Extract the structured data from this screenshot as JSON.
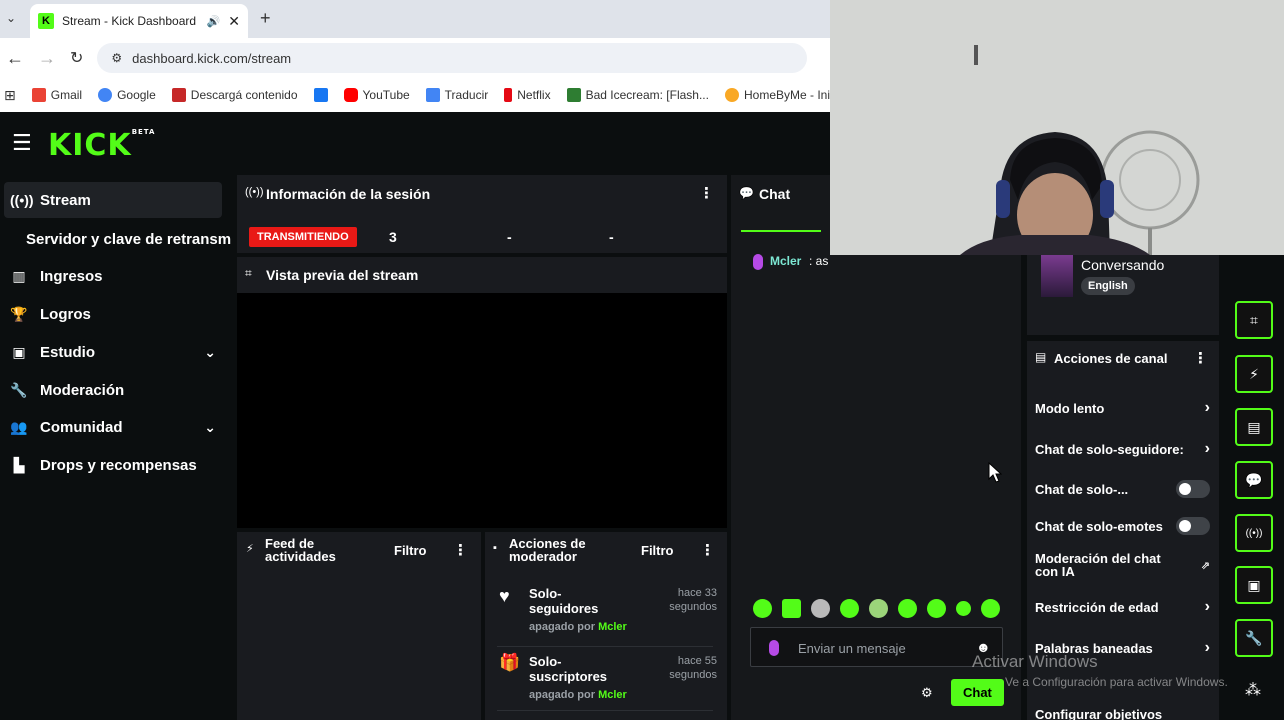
{
  "browser": {
    "tab_title": "Stream - Kick Dashboard",
    "url": "dashboard.kick.com/stream",
    "bookmarks": [
      "Gmail",
      "Google",
      "Descargá contenido",
      "YouTube",
      "Traducir",
      "Netflix",
      "Bad Icecream: [Flash...",
      "HomeByMe - Inic"
    ]
  },
  "sidebar": {
    "items": [
      {
        "label": "Stream"
      },
      {
        "label": "Servidor y clave de retransm"
      },
      {
        "label": "Ingresos"
      },
      {
        "label": "Logros"
      },
      {
        "label": "Estudio"
      },
      {
        "label": "Moderación"
      },
      {
        "label": "Comunidad"
      },
      {
        "label": "Drops y recompensas"
      }
    ]
  },
  "session": {
    "title": "Información de la sesión",
    "status_badge": "TRANSMITIENDO",
    "stat1": "3",
    "stat2": "-",
    "stat3": "-"
  },
  "preview": {
    "title": "Vista previa del stream"
  },
  "activity_feed": {
    "title": "Feed de actividades",
    "filter": "Filtro"
  },
  "mod_actions": {
    "title": "Acciones de moderador",
    "filter": "Filtro",
    "items": [
      {
        "title": "Solo-seguidores",
        "time": "hace 33 segundos",
        "by_prefix": "apagado por",
        "user": "Mcler"
      },
      {
        "title": "Solo-suscriptores",
        "time": "hace 55 segundos",
        "by_prefix": "apagado por",
        "user": "Mcler"
      }
    ]
  },
  "chat": {
    "title": "Chat",
    "message_user": "Mcler",
    "message_text": "as",
    "input_placeholder": "Enviar un mensaje",
    "send_button": "Chat"
  },
  "stream_info": {
    "category": "Conversando",
    "tag": "English"
  },
  "channel_actions": {
    "title": "Acciones de canal",
    "items": [
      {
        "label": "Modo lento"
      },
      {
        "label": "Chat de solo-seguidore:"
      },
      {
        "label": "Chat de solo-..."
      },
      {
        "label": "Chat de solo-emotes"
      },
      {
        "label": "Moderación del chat con IA"
      },
      {
        "label": "Restricción de edad"
      },
      {
        "label": "Palabras baneadas"
      },
      {
        "label": "Configurar objetivos"
      }
    ]
  },
  "watermark": {
    "line1": "Activar Windows",
    "line2": "Ve a Configuración para activar Windows."
  },
  "colors": {
    "accent": "#53fc18",
    "live": "#e91916",
    "panel": "#191b1f"
  }
}
